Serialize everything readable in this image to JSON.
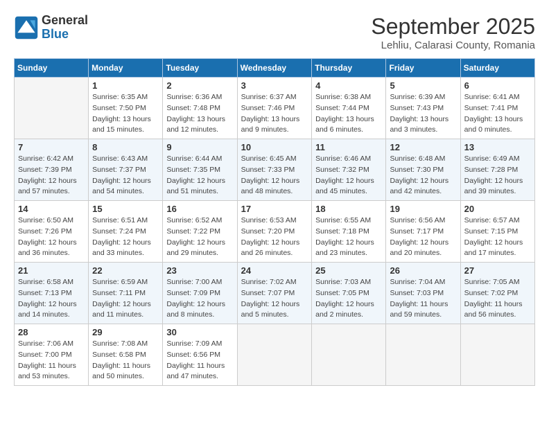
{
  "logo": {
    "line1": "General",
    "line2": "Blue"
  },
  "title": "September 2025",
  "subtitle": "Lehliu, Calarasi County, Romania",
  "weekdays": [
    "Sunday",
    "Monday",
    "Tuesday",
    "Wednesday",
    "Thursday",
    "Friday",
    "Saturday"
  ],
  "weeks": [
    [
      {
        "day": "",
        "info": ""
      },
      {
        "day": "1",
        "info": "Sunrise: 6:35 AM\nSunset: 7:50 PM\nDaylight: 13 hours\nand 15 minutes."
      },
      {
        "day": "2",
        "info": "Sunrise: 6:36 AM\nSunset: 7:48 PM\nDaylight: 13 hours\nand 12 minutes."
      },
      {
        "day": "3",
        "info": "Sunrise: 6:37 AM\nSunset: 7:46 PM\nDaylight: 13 hours\nand 9 minutes."
      },
      {
        "day": "4",
        "info": "Sunrise: 6:38 AM\nSunset: 7:44 PM\nDaylight: 13 hours\nand 6 minutes."
      },
      {
        "day": "5",
        "info": "Sunrise: 6:39 AM\nSunset: 7:43 PM\nDaylight: 13 hours\nand 3 minutes."
      },
      {
        "day": "6",
        "info": "Sunrise: 6:41 AM\nSunset: 7:41 PM\nDaylight: 13 hours\nand 0 minutes."
      }
    ],
    [
      {
        "day": "7",
        "info": "Sunrise: 6:42 AM\nSunset: 7:39 PM\nDaylight: 12 hours\nand 57 minutes."
      },
      {
        "day": "8",
        "info": "Sunrise: 6:43 AM\nSunset: 7:37 PM\nDaylight: 12 hours\nand 54 minutes."
      },
      {
        "day": "9",
        "info": "Sunrise: 6:44 AM\nSunset: 7:35 PM\nDaylight: 12 hours\nand 51 minutes."
      },
      {
        "day": "10",
        "info": "Sunrise: 6:45 AM\nSunset: 7:33 PM\nDaylight: 12 hours\nand 48 minutes."
      },
      {
        "day": "11",
        "info": "Sunrise: 6:46 AM\nSunset: 7:32 PM\nDaylight: 12 hours\nand 45 minutes."
      },
      {
        "day": "12",
        "info": "Sunrise: 6:48 AM\nSunset: 7:30 PM\nDaylight: 12 hours\nand 42 minutes."
      },
      {
        "day": "13",
        "info": "Sunrise: 6:49 AM\nSunset: 7:28 PM\nDaylight: 12 hours\nand 39 minutes."
      }
    ],
    [
      {
        "day": "14",
        "info": "Sunrise: 6:50 AM\nSunset: 7:26 PM\nDaylight: 12 hours\nand 36 minutes."
      },
      {
        "day": "15",
        "info": "Sunrise: 6:51 AM\nSunset: 7:24 PM\nDaylight: 12 hours\nand 33 minutes."
      },
      {
        "day": "16",
        "info": "Sunrise: 6:52 AM\nSunset: 7:22 PM\nDaylight: 12 hours\nand 29 minutes."
      },
      {
        "day": "17",
        "info": "Sunrise: 6:53 AM\nSunset: 7:20 PM\nDaylight: 12 hours\nand 26 minutes."
      },
      {
        "day": "18",
        "info": "Sunrise: 6:55 AM\nSunset: 7:18 PM\nDaylight: 12 hours\nand 23 minutes."
      },
      {
        "day": "19",
        "info": "Sunrise: 6:56 AM\nSunset: 7:17 PM\nDaylight: 12 hours\nand 20 minutes."
      },
      {
        "day": "20",
        "info": "Sunrise: 6:57 AM\nSunset: 7:15 PM\nDaylight: 12 hours\nand 17 minutes."
      }
    ],
    [
      {
        "day": "21",
        "info": "Sunrise: 6:58 AM\nSunset: 7:13 PM\nDaylight: 12 hours\nand 14 minutes."
      },
      {
        "day": "22",
        "info": "Sunrise: 6:59 AM\nSunset: 7:11 PM\nDaylight: 12 hours\nand 11 minutes."
      },
      {
        "day": "23",
        "info": "Sunrise: 7:00 AM\nSunset: 7:09 PM\nDaylight: 12 hours\nand 8 minutes."
      },
      {
        "day": "24",
        "info": "Sunrise: 7:02 AM\nSunset: 7:07 PM\nDaylight: 12 hours\nand 5 minutes."
      },
      {
        "day": "25",
        "info": "Sunrise: 7:03 AM\nSunset: 7:05 PM\nDaylight: 12 hours\nand 2 minutes."
      },
      {
        "day": "26",
        "info": "Sunrise: 7:04 AM\nSunset: 7:03 PM\nDaylight: 11 hours\nand 59 minutes."
      },
      {
        "day": "27",
        "info": "Sunrise: 7:05 AM\nSunset: 7:02 PM\nDaylight: 11 hours\nand 56 minutes."
      }
    ],
    [
      {
        "day": "28",
        "info": "Sunrise: 7:06 AM\nSunset: 7:00 PM\nDaylight: 11 hours\nand 53 minutes."
      },
      {
        "day": "29",
        "info": "Sunrise: 7:08 AM\nSunset: 6:58 PM\nDaylight: 11 hours\nand 50 minutes."
      },
      {
        "day": "30",
        "info": "Sunrise: 7:09 AM\nSunset: 6:56 PM\nDaylight: 11 hours\nand 47 minutes."
      },
      {
        "day": "",
        "info": ""
      },
      {
        "day": "",
        "info": ""
      },
      {
        "day": "",
        "info": ""
      },
      {
        "day": "",
        "info": ""
      }
    ]
  ]
}
